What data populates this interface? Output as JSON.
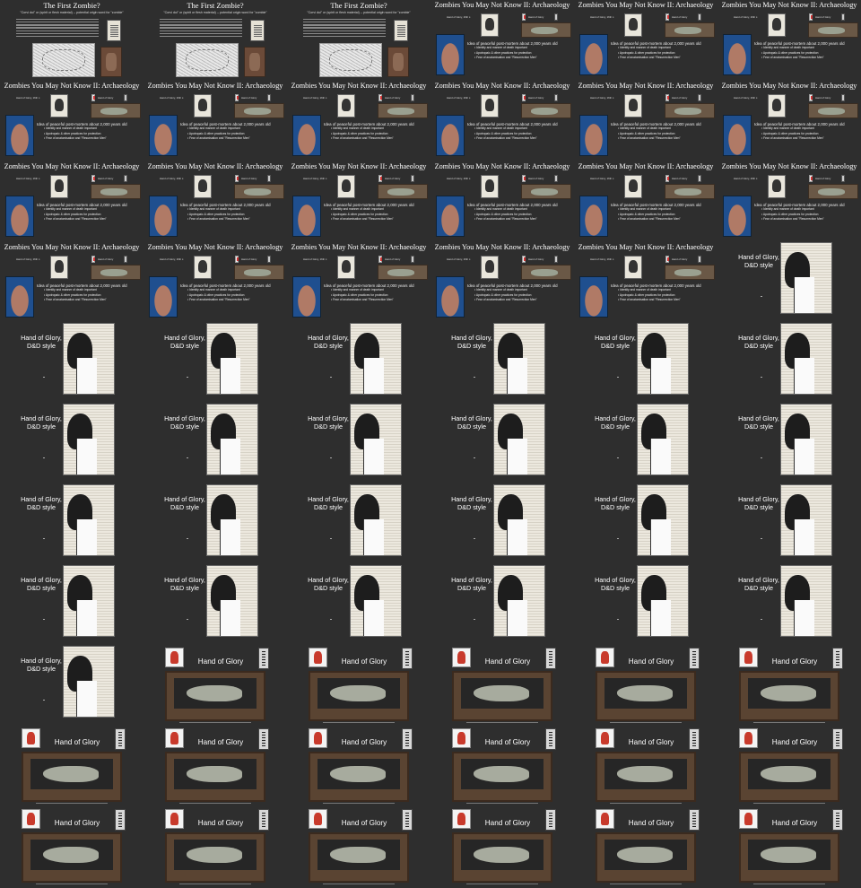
{
  "slides": {
    "first_zombie": {
      "title": "The First Zombie?",
      "subtitle": "\"Corvi dui\" or (spirit or flesh material) -- potential origin word for \"zombie\""
    },
    "archaeology": {
      "title": "Zombies You May Not Know II: Archaeology",
      "portrait_label": "Hand of Glory, 16th c.",
      "hog_label": "Hand of Glory",
      "heading": "Idea of peaceful post-mortem about 2,000 years old",
      "bullets": [
        "Identity and manner of death important",
        "Apotropaic & other practices for protection",
        "Fear of anatomisation and \"Resurrection Men\""
      ]
    },
    "dnd": {
      "title_line1": "Hand of Glory,",
      "title_line2": "D&D style"
    },
    "hand_of_glory": {
      "title": "Hand of Glory"
    }
  },
  "grid": [
    [
      "first_zombie",
      "first_zombie",
      "first_zombie",
      "archaeology",
      "archaeology",
      "archaeology"
    ],
    [
      "archaeology",
      "archaeology",
      "archaeology",
      "archaeology",
      "archaeology",
      "archaeology"
    ],
    [
      "archaeology",
      "archaeology",
      "archaeology",
      "archaeology",
      "archaeology",
      "archaeology"
    ],
    [
      "archaeology",
      "archaeology",
      "archaeology",
      "archaeology",
      "archaeology",
      "dnd"
    ],
    [
      "dnd",
      "dnd",
      "dnd",
      "dnd",
      "dnd",
      "dnd"
    ],
    [
      "dnd",
      "dnd",
      "dnd",
      "dnd",
      "dnd",
      "dnd"
    ],
    [
      "dnd",
      "dnd",
      "dnd",
      "dnd",
      "dnd",
      "dnd"
    ],
    [
      "dnd",
      "dnd",
      "dnd",
      "dnd",
      "dnd",
      "dnd"
    ],
    [
      "dnd",
      "hand_of_glory",
      "hand_of_glory",
      "hand_of_glory",
      "hand_of_glory",
      "hand_of_glory"
    ],
    [
      "hand_of_glory",
      "hand_of_glory",
      "hand_of_glory",
      "hand_of_glory",
      "hand_of_glory",
      "hand_of_glory"
    ],
    [
      "hand_of_glory",
      "hand_of_glory",
      "hand_of_glory",
      "hand_of_glory",
      "hand_of_glory",
      "hand_of_glory"
    ]
  ]
}
